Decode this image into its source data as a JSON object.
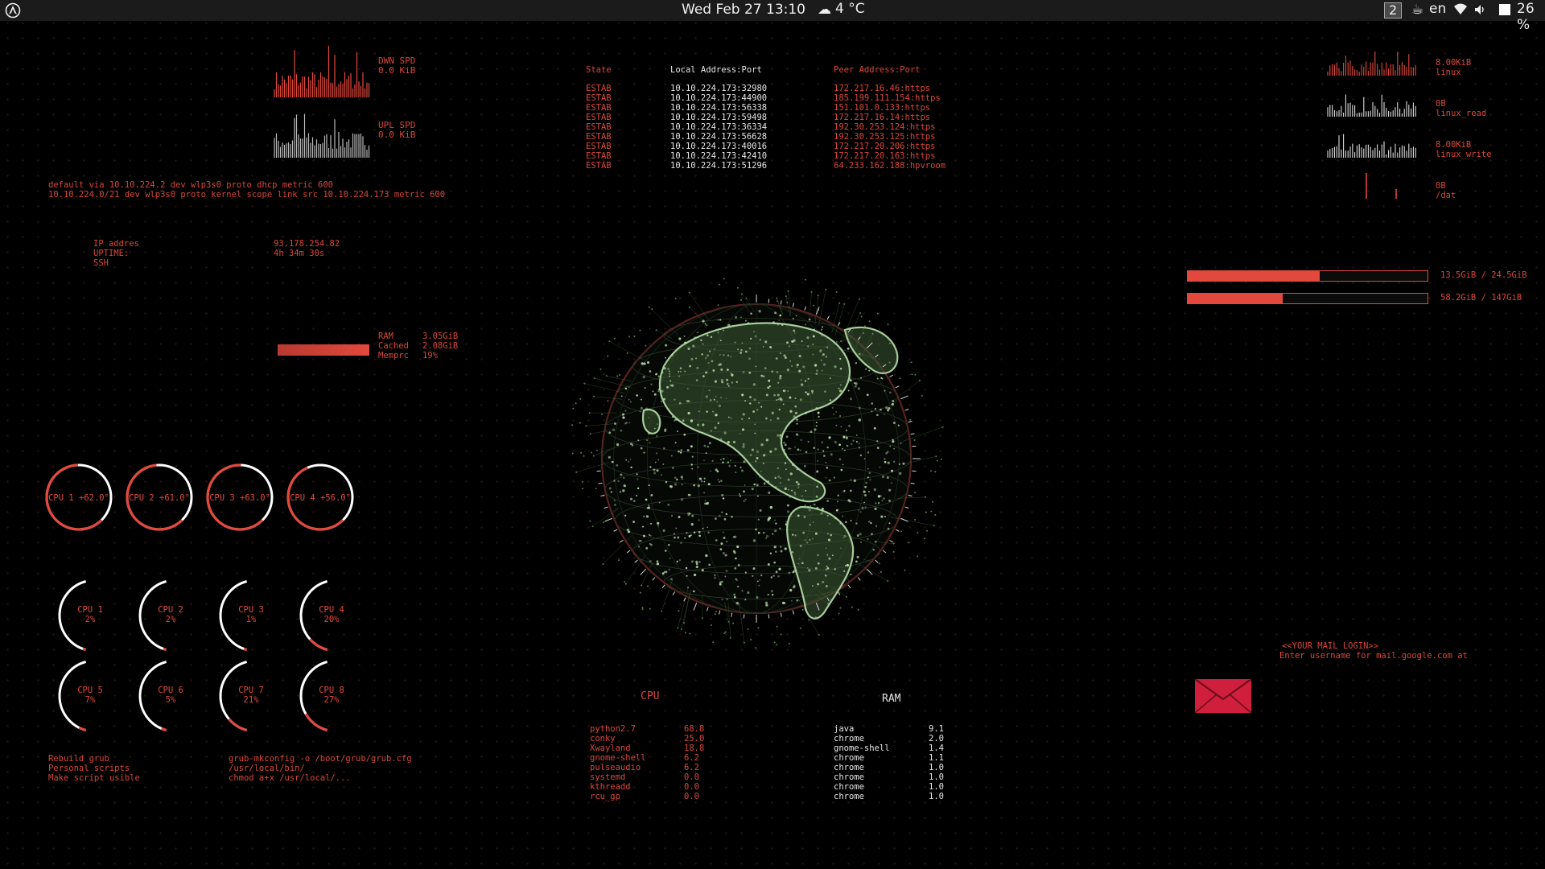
{
  "topbar": {
    "clock": "Wed Feb 27  13:10",
    "weather": "4 °C",
    "workspace": "2",
    "language": "en",
    "battery": "26 %"
  },
  "network": {
    "down_label": "DWN SPD",
    "down_value": "0.0 KiB",
    "up_label": "UPL SPD",
    "up_value": "0.0 KiB"
  },
  "routes": [
    "default via 10.10.224.2 dev wlp3s0 proto dhcp metric 600",
    "10.10.224.0/21 dev wlp3s0 proto kernel scope link src 10.10.224.173 metric 600"
  ],
  "sysinfo": {
    "labels": [
      "IP addres",
      "UPTIME:",
      "SSH"
    ],
    "values": [
      "93.178.254.82",
      "4h 34m 30s",
      ""
    ]
  },
  "memory": {
    "labels": [
      "RAM",
      "Cached",
      "Memprc"
    ],
    "values": [
      "3.05GiB",
      "2.08GiB",
      "19%"
    ],
    "percent": 19
  },
  "cpu_temps": [
    {
      "label": "CPU 1 +62.0°",
      "fraction": 0.62
    },
    {
      "label": "CPU 2 +61.0°",
      "fraction": 0.61
    },
    {
      "label": "CPU 3 +63.0°",
      "fraction": 0.63
    },
    {
      "label": "CPU 4 +56.0°",
      "fraction": 0.56
    }
  ],
  "cpu_usage": [
    {
      "name": "CPU 1",
      "value": "2%",
      "fraction": 0.02
    },
    {
      "name": "CPU 2",
      "value": "2%",
      "fraction": 0.02
    },
    {
      "name": "CPU 3",
      "value": "1%",
      "fraction": 0.01
    },
    {
      "name": "CPU 4",
      "value": "20%",
      "fraction": 0.2
    },
    {
      "name": "CPU 5",
      "value": "7%",
      "fraction": 0.07
    },
    {
      "name": "CPU 6",
      "value": "5%",
      "fraction": 0.05
    },
    {
      "name": "CPU 7",
      "value": "21%",
      "fraction": 0.21
    },
    {
      "name": "CPU 8",
      "value": "27%",
      "fraction": 0.27
    }
  ],
  "notes": {
    "left": [
      "Rebuild grub",
      "Personal scripts",
      "Make script usible"
    ],
    "right": [
      "grub-mkconfig -o /boot/grub/grub.cfg",
      "/usr/local/bin/",
      "chmod a+x /usr/local/..."
    ]
  },
  "connections": {
    "headers": [
      "State",
      "Local Address:Port",
      "Peer Address:Port"
    ],
    "rows": [
      [
        "ESTAB",
        "10.10.224.173:32980",
        "172.217.16.46:https"
      ],
      [
        "ESTAB",
        "10.10.224.173:44900",
        "185.199.111.154:https"
      ],
      [
        "ESTAB",
        "10.10.224.173:56338",
        "151.101.0.133:https"
      ],
      [
        "ESTAB",
        "10.10.224.173:59498",
        "172.217.16.14:https"
      ],
      [
        "ESTAB",
        "10.10.224.173:36334",
        "192.30.253.124:https"
      ],
      [
        "ESTAB",
        "10.10.224.173:56628",
        "192.30.253.125:https"
      ],
      [
        "ESTAB",
        "10.10.224.173:40016",
        "172.217.20.206:https"
      ],
      [
        "ESTAB",
        "10.10.224.173:42410",
        "172.217.20.163:https"
      ],
      [
        "ESTAB",
        "10.10.224.173:51296",
        "64.233.162.188:hpvroom"
      ]
    ]
  },
  "disk_io": [
    {
      "value": "8.00KiB",
      "name": "linux",
      "color": "#e2493c"
    },
    {
      "value": "0B",
      "name": "linux_read",
      "color": "#dddddd"
    },
    {
      "value": "8.00KiB",
      "name": "linux_write",
      "color": "#dddddd"
    },
    {
      "value": "0B",
      "name": "/dat",
      "color": "#e2493c"
    }
  ],
  "storage": [
    {
      "label": "13.5GiB / 24.5GiB",
      "fraction": 0.551
    },
    {
      "label": "58.2GiB / 147GiB",
      "fraction": 0.396
    }
  ],
  "top_cpu": {
    "title": "CPU",
    "names": [
      "python2.7",
      "conky",
      "Xwayland",
      "gnome-shell",
      "pulseaudio",
      "systemd",
      "kthreadd",
      "rcu_gp"
    ],
    "values": [
      "68.8",
      "25.0",
      "18.8",
      "6.2",
      "6.2",
      "0.0",
      "0.0",
      "0.0"
    ]
  },
  "top_ram": {
    "title": "RAM",
    "names": [
      "java",
      "chrome",
      "gnome-shell",
      "chrome",
      "chrome",
      "chrome",
      "chrome",
      "chrome"
    ],
    "values": [
      "9.1",
      "2.0",
      "1.4",
      "1.1",
      "1.0",
      "1.0",
      "1.0",
      "1.0"
    ]
  },
  "mail": {
    "line1": "<<YOUR MAIL LOGIN>>",
    "line2": "Enter username for mail.google.com at"
  },
  "colors": {
    "accent": "#e2493c",
    "globe": "#b8e0a8",
    "background": "#000000"
  }
}
